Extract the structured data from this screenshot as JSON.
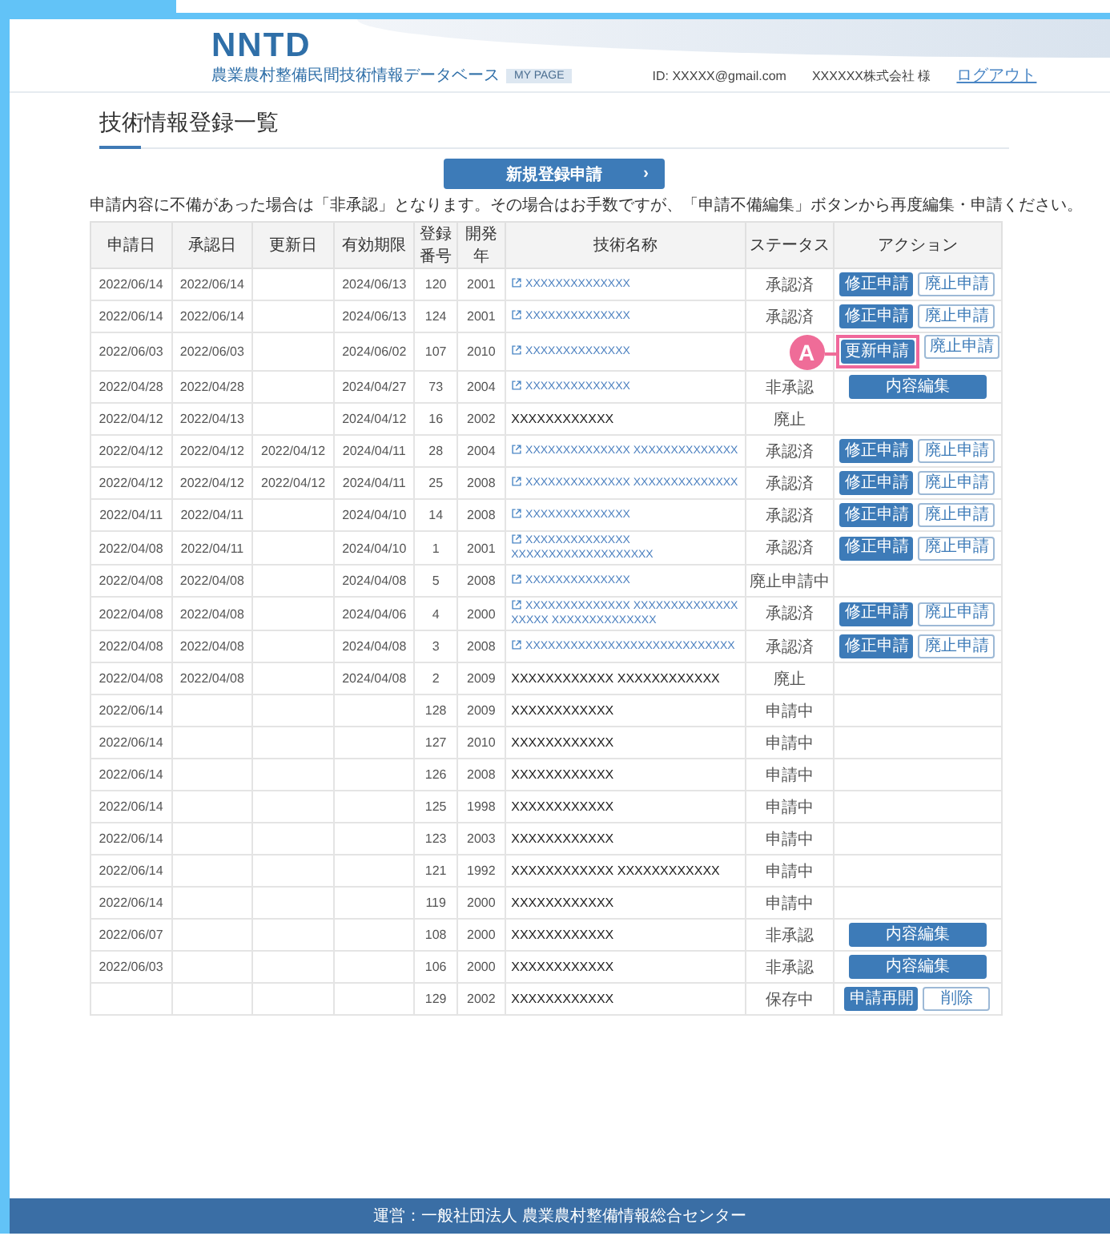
{
  "header": {
    "logo": "NNTD",
    "subtitle": "農業農村整備民間技術情報データベース",
    "badge": "MY PAGE",
    "user_id": "ID: XXXXX@gmail.com",
    "company": "XXXXXX株式会社 様",
    "logout": "ログアウト"
  },
  "page_title": "技術情報登録一覧",
  "new_button": {
    "label": "新規登録申請",
    "arrow": "›"
  },
  "notice": "申請内容に不備があった場合は「非承認」となります。その場合はお手数ですが、「申請不備編集」ボタンから再度編集・申請ください。",
  "table": {
    "columns": [
      "申請日",
      "承認日",
      "更新日",
      "有効期限",
      "登録番号",
      "開発年",
      "技術名称",
      "ステータス",
      "アクション"
    ],
    "rows": [
      {
        "applied": "2022/06/14",
        "approved": "2022/06/14",
        "expires": "2024/06/13",
        "number": "120",
        "year": "2001",
        "name": "XXXXXXXXXXXXXX",
        "link": true,
        "status": "承認済",
        "actions": [
          {
            "label": "修正申請",
            "kind": "primary"
          },
          {
            "label": "廃止申請",
            "kind": "outline"
          }
        ]
      },
      {
        "applied": "2022/06/14",
        "approved": "2022/06/14",
        "expires": "2024/06/13",
        "number": "124",
        "year": "2001",
        "name": "XXXXXXXXXXXXXX",
        "link": true,
        "status": "承認済",
        "actions": [
          {
            "label": "修正申請",
            "kind": "primary"
          },
          {
            "label": "廃止申請",
            "kind": "outline"
          }
        ]
      },
      {
        "applied": "2022/06/03",
        "approved": "2022/06/03",
        "expires": "2024/06/02",
        "number": "107",
        "year": "2010",
        "name": "XXXXXXXXXXXXXX",
        "link": true,
        "actions": [
          {
            "label": "更新申請",
            "kind": "primary",
            "callout": "A"
          },
          {
            "label": "廃止申請",
            "kind": "outline"
          }
        ]
      },
      {
        "applied": "2022/04/28",
        "approved": "2022/04/28",
        "expires": "2024/04/27",
        "number": "73",
        "year": "2004",
        "name": "XXXXXXXXXXXXXX",
        "link": true,
        "status": "非承認",
        "actions": [
          {
            "label": "内容編集",
            "kind": "wide"
          }
        ]
      },
      {
        "applied": "2022/04/12",
        "approved": "2022/04/13",
        "expires": "2024/04/12",
        "number": "16",
        "year": "2002",
        "name": "XXXXXXXXXXXX",
        "link": false,
        "status": "廃止"
      },
      {
        "applied": "2022/04/12",
        "approved": "2022/04/12",
        "updated": "2022/04/12",
        "expires": "2024/04/11",
        "number": "28",
        "year": "2004",
        "name": "XXXXXXXXXXXXXX XXXXXXXXXXXXXX",
        "link": true,
        "status": "承認済",
        "actions": [
          {
            "label": "修正申請",
            "kind": "primary"
          },
          {
            "label": "廃止申請",
            "kind": "outline"
          }
        ]
      },
      {
        "applied": "2022/04/12",
        "approved": "2022/04/12",
        "updated": "2022/04/12",
        "expires": "2024/04/11",
        "number": "25",
        "year": "2008",
        "name": "XXXXXXXXXXXXXX XXXXXXXXXXXXXX",
        "link": true,
        "status": "承認済",
        "actions": [
          {
            "label": "修正申請",
            "kind": "primary"
          },
          {
            "label": "廃止申請",
            "kind": "outline"
          }
        ]
      },
      {
        "applied": "2022/04/11",
        "approved": "2022/04/11",
        "expires": "2024/04/10",
        "number": "14",
        "year": "2008",
        "name": "XXXXXXXXXXXXXX",
        "link": true,
        "status": "承認済",
        "actions": [
          {
            "label": "修正申請",
            "kind": "primary"
          },
          {
            "label": "廃止申請",
            "kind": "outline"
          }
        ]
      },
      {
        "applied": "2022/04/08",
        "approved": "2022/04/11",
        "expires": "2024/04/10",
        "number": "1",
        "year": "2001",
        "name": "XXXXXXXXXXXXXX XXXXXXXXXXXXXXXXXXX",
        "link": true,
        "status": "承認済",
        "actions": [
          {
            "label": "修正申請",
            "kind": "primary"
          },
          {
            "label": "廃止申請",
            "kind": "outline"
          }
        ]
      },
      {
        "applied": "2022/04/08",
        "approved": "2022/04/08",
        "expires": "2024/04/08",
        "number": "5",
        "year": "2008",
        "name": "XXXXXXXXXXXXXX",
        "link": true,
        "status": "廃止申請中"
      },
      {
        "applied": "2022/04/08",
        "approved": "2022/04/08",
        "expires": "2024/04/06",
        "number": "4",
        "year": "2000",
        "name": "XXXXXXXXXXXXXX XXXXXXXXXXXXXX XXXXX XXXXXXXXXXXXXX",
        "link": true,
        "status": "承認済",
        "actions": [
          {
            "label": "修正申請",
            "kind": "primary"
          },
          {
            "label": "廃止申請",
            "kind": "outline"
          }
        ]
      },
      {
        "applied": "2022/04/08",
        "approved": "2022/04/08",
        "expires": "2024/04/08",
        "number": "3",
        "year": "2008",
        "name": "XXXXXXXXXXXXXXXXXXXXXXXXXXXX",
        "link": true,
        "status": "承認済",
        "actions": [
          {
            "label": "修正申請",
            "kind": "primary"
          },
          {
            "label": "廃止申請",
            "kind": "outline"
          }
        ]
      },
      {
        "applied": "2022/04/08",
        "approved": "2022/04/08",
        "expires": "2024/04/08",
        "number": "2",
        "year": "2009",
        "name": "XXXXXXXXXXXX XXXXXXXXXXXX",
        "link": false,
        "status": "廃止"
      },
      {
        "applied": "2022/06/14",
        "number": "128",
        "year": "2009",
        "name": "XXXXXXXXXXXX",
        "link": false,
        "status": "申請中"
      },
      {
        "applied": "2022/06/14",
        "number": "127",
        "year": "2010",
        "name": "XXXXXXXXXXXX",
        "link": false,
        "status": "申請中"
      },
      {
        "applied": "2022/06/14",
        "number": "126",
        "year": "2008",
        "name": "XXXXXXXXXXXX",
        "link": false,
        "status": "申請中"
      },
      {
        "applied": "2022/06/14",
        "number": "125",
        "year": "1998",
        "name": "XXXXXXXXXXXX",
        "link": false,
        "status": "申請中"
      },
      {
        "applied": "2022/06/14",
        "number": "123",
        "year": "2003",
        "name": "XXXXXXXXXXXX",
        "link": false,
        "status": "申請中"
      },
      {
        "applied": "2022/06/14",
        "number": "121",
        "year": "1992",
        "name": "XXXXXXXXXXXX XXXXXXXXXXXX",
        "link": false,
        "status": "申請中"
      },
      {
        "applied": "2022/06/14",
        "number": "119",
        "year": "2000",
        "name": "XXXXXXXXXXXX",
        "link": false,
        "status": "申請中"
      },
      {
        "applied": "2022/06/07",
        "number": "108",
        "year": "2000",
        "name": "XXXXXXXXXXXX",
        "link": false,
        "status": "非承認",
        "actions": [
          {
            "label": "内容編集",
            "kind": "wide"
          }
        ]
      },
      {
        "applied": "2022/06/03",
        "number": "106",
        "year": "2000",
        "name": "XXXXXXXXXXXX",
        "link": false,
        "status": "非承認",
        "actions": [
          {
            "label": "内容編集",
            "kind": "wide"
          }
        ]
      },
      {
        "number": "129",
        "year": "2002",
        "name": "XXXXXXXXXXXX",
        "link": false,
        "status": "保存中",
        "actions": [
          {
            "label": "申請再開",
            "kind": "primary"
          },
          {
            "label": "削除",
            "kind": "outline"
          }
        ]
      }
    ]
  },
  "footer": "運営：一般社団法人 農業農村整備情報総合センター"
}
